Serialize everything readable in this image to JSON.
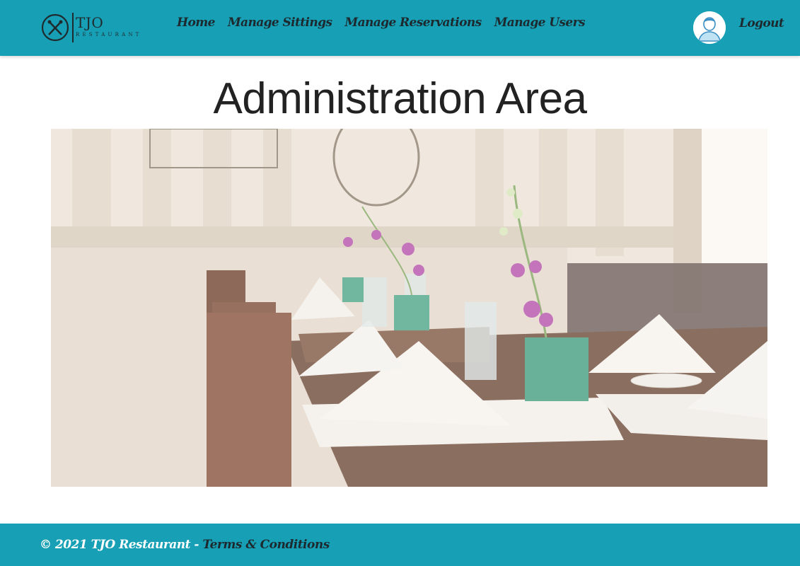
{
  "header": {
    "logo": {
      "name": "TJO",
      "subtitle": "RESTAURANT"
    },
    "nav": [
      {
        "label": "Home"
      },
      {
        "label": "Manage Sittings"
      },
      {
        "label": "Manage Reservations"
      },
      {
        "label": "Manage Users"
      }
    ],
    "logout_label": "Logout",
    "avatar_icon": "user-avatar-icon"
  },
  "main": {
    "title": "Administration Area",
    "hero_image": "restaurant-tables-photo"
  },
  "footer": {
    "copyright": "© 2021 TJO Restaurant",
    "separator": " - ",
    "terms_label": "Terms & Conditions"
  },
  "colors": {
    "brand": "#17a0b5",
    "nav_text": "#1c2a30",
    "footer_text": "#ffffff"
  }
}
